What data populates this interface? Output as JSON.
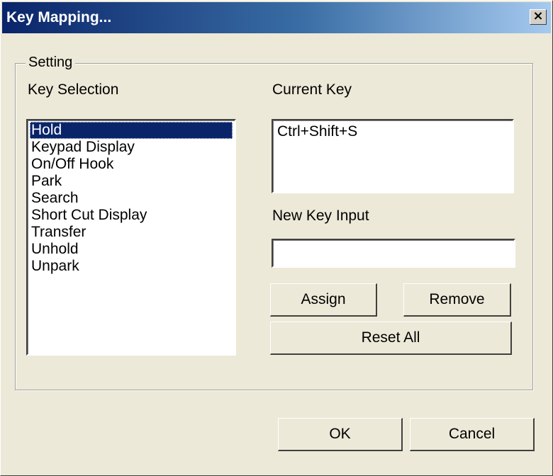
{
  "window": {
    "title": "Key Mapping...",
    "close_glyph": "×"
  },
  "group": {
    "legend": "Setting"
  },
  "key_selection": {
    "label": "Key Selection",
    "items": [
      "Hold",
      "Keypad Display",
      "On/Off Hook",
      "Park",
      "Search",
      "Short Cut Display",
      "Transfer",
      "Unhold",
      "Unpark"
    ],
    "selected": "Hold"
  },
  "current_key": {
    "label": "Current Key",
    "value": "Ctrl+Shift+S"
  },
  "new_key_input": {
    "label": "New Key Input",
    "value": ""
  },
  "buttons": {
    "assign": "Assign",
    "remove": "Remove",
    "reset_all": "Reset All",
    "ok": "OK",
    "cancel": "Cancel"
  },
  "colors": {
    "title_start": "#0a246a",
    "title_end": "#a6caf0",
    "selection": "#0a246a",
    "dialog_bg": "#ece9d8"
  },
  "icons": {
    "close": "close-icon"
  }
}
